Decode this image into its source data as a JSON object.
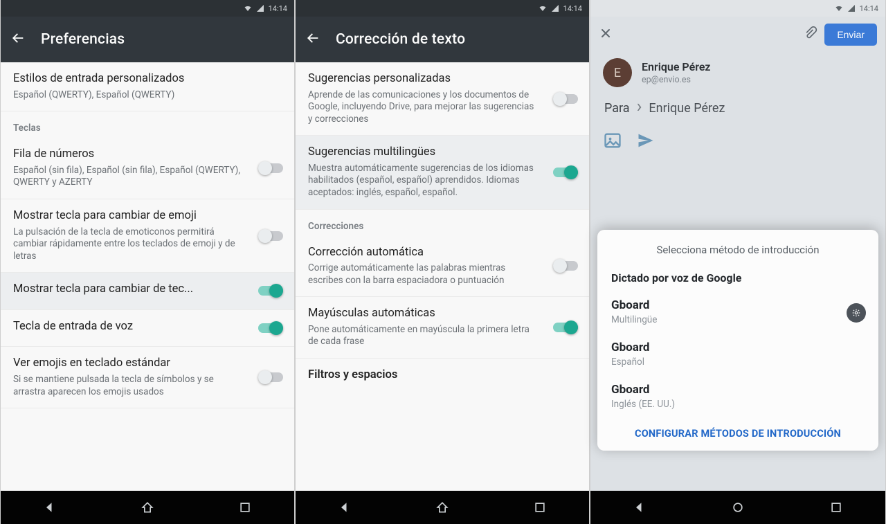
{
  "status_time": "14:14",
  "phone1": {
    "title": "Preferencias",
    "items": [
      {
        "t": "Estilos de entrada personalizados",
        "s": "Español (QWERTY), Español (QWERTY)",
        "toggle": null
      },
      {
        "section": "Teclas"
      },
      {
        "t": "Fila de números",
        "s": "Español (sin fila), Español (sin fila), Español (QWERTY), QWERTY y AZERTY",
        "toggle": false
      },
      {
        "t": "Mostrar tecla para cambiar de emoji",
        "s": "La pulsación de la tecla de emoticonos permitirá cambiar rápidamente entre los teclados de emoji y de letras",
        "toggle": false,
        "hl": false
      },
      {
        "t": "Mostrar tecla para cambiar de tec...",
        "s": "",
        "toggle": true,
        "hl": true
      },
      {
        "t": "Tecla de entrada de voz",
        "s": "",
        "toggle": true
      },
      {
        "t": "Ver emojis en teclado estándar",
        "s": "Si se mantiene pulsada la tecla de símbolos y se arrastra aparecen los emojis usados",
        "toggle": false
      }
    ]
  },
  "phone2": {
    "title": "Corrección de texto",
    "items": [
      {
        "t": "Sugerencias personalizadas",
        "s": "Aprende de las comunicaciones y los documentos de Google, incluyendo Drive, para mejorar las sugerencias y correcciones",
        "toggle": false
      },
      {
        "t": "Sugerencias multilingües",
        "s": "Muestra automáticamente sugerencias de los idiomas habilitados (español, español) aprendidos. Idiomas aceptados: inglés, español, español.",
        "toggle": true,
        "hl": true
      },
      {
        "section": "Correcciones",
        "gray": true
      },
      {
        "t": "Corrección automática",
        "s": "Corrige automáticamente las palabras mientras escribes con la barra espaciadora o puntuación",
        "toggle": false
      },
      {
        "t": "Mayúsculas automáticas",
        "s": "Pone automáticamente en mayúscula la primera letra de cada frase",
        "toggle": true
      },
      {
        "section_plain": "Filtros y espacios"
      }
    ]
  },
  "phone3": {
    "send": "Enviar",
    "from_name": "Enrique Pérez",
    "from_email": "ep@envio.es",
    "to_label": "Para",
    "to_value": "Enrique Pérez",
    "sheet": {
      "header": "Selecciona método de introducción",
      "sub": "Dictado por voz de Google",
      "opts": [
        {
          "t": "Gboard",
          "s": "Multilingüe",
          "plus": true
        },
        {
          "t": "Gboard",
          "s": "Español"
        },
        {
          "t": "Gboard",
          "s": "Inglés (EE. UU.)"
        }
      ],
      "footer": "CONFIGURAR MÉTODOS DE INTRODUCCIÓN"
    }
  }
}
